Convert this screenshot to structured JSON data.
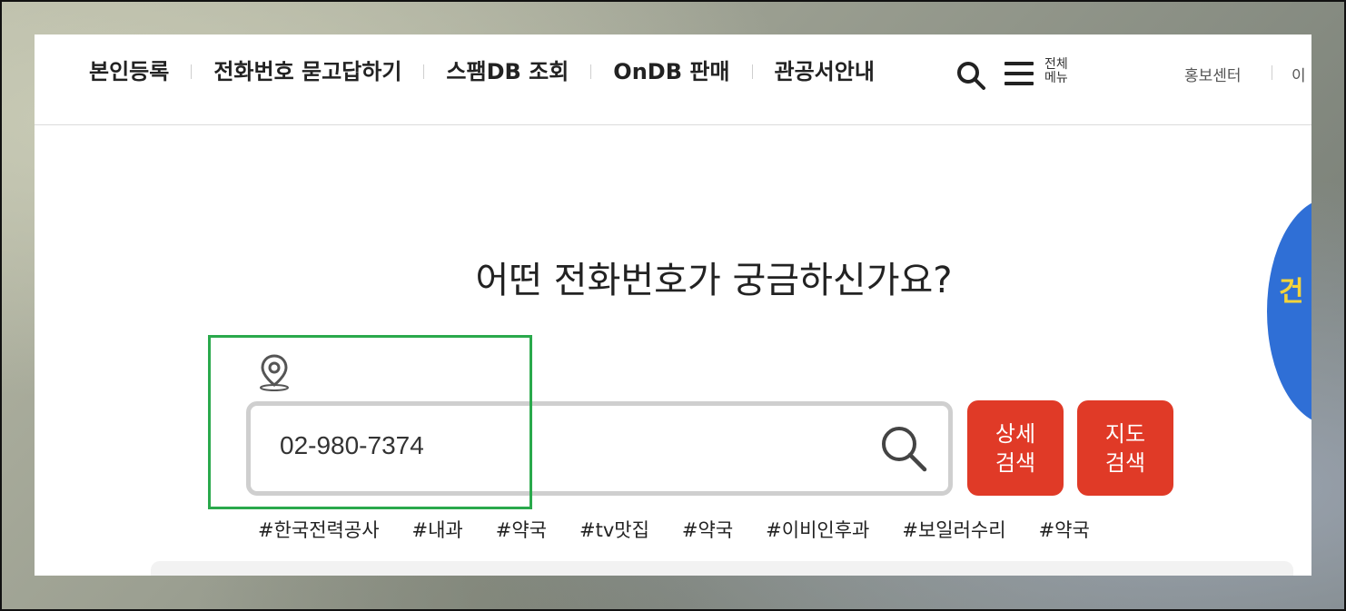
{
  "nav": {
    "items": [
      "본인등록",
      "전화번호 묻고답하기",
      "스팸DB 조회",
      "OnDB 판매",
      "관공서안내"
    ],
    "all_menu_label": "전체\n메뉴",
    "util_links": [
      "홍보센터",
      "이"
    ]
  },
  "main": {
    "headline": "어떤 전화번호가 궁금하신가요?",
    "search_value": "02-980-7374",
    "detail_search_label": "상세\n검색",
    "map_search_label": "지도\n검색",
    "tags": [
      "#한국전력공사",
      "#내과",
      "#약국",
      "#tv맛집",
      "#약국",
      "#이비인후과",
      "#보일러수리",
      "#약국"
    ]
  },
  "side_promo": {
    "text": "건"
  },
  "icons": {
    "search": "search-icon",
    "menu": "hamburger-menu-icon",
    "location": "location-pin-icon"
  },
  "colors": {
    "accent": "#e03a27",
    "highlight": "#2aa94c",
    "promo": "#2f6fd6"
  }
}
